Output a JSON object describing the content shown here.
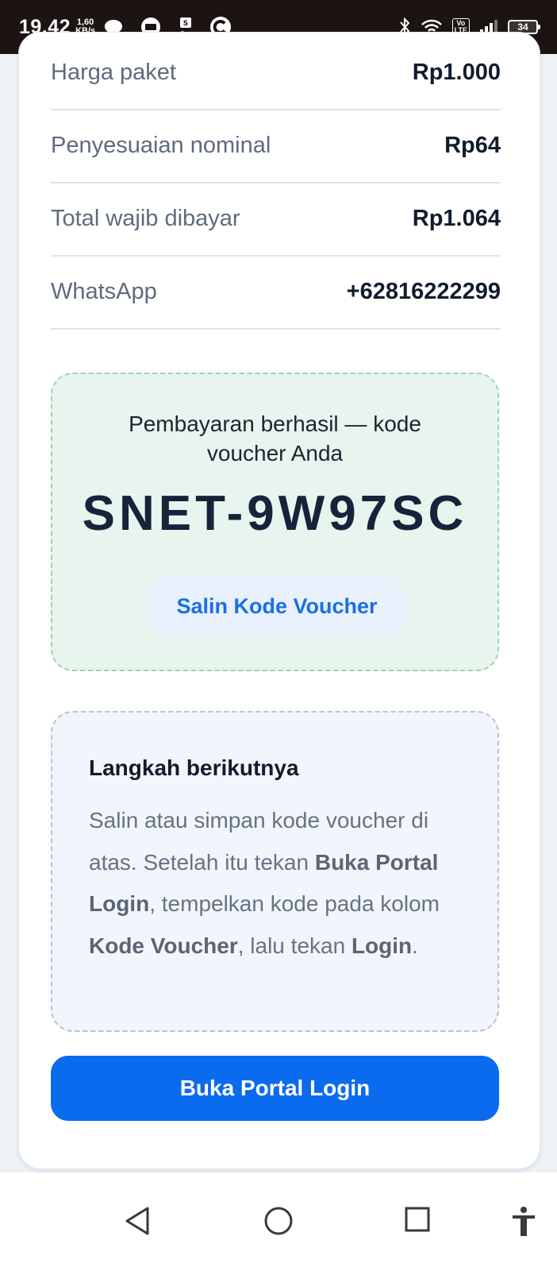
{
  "status_bar": {
    "time": "19.42",
    "speed_value": "1,60",
    "speed_unit": "KB/s",
    "battery": "34",
    "network_badge_top": "Vo",
    "network_badge_bottom": "LTE",
    "icons": [
      "chat-bubble-icon",
      "message-icon",
      "shopeepay-icon",
      "c-app-icon",
      "bluetooth-icon",
      "wifi-icon",
      "volte-icon",
      "signal-icon",
      "battery-icon"
    ]
  },
  "summary": {
    "rows": [
      {
        "label": "Harga paket",
        "value": "Rp1.000"
      },
      {
        "label": "Penyesuaian nominal",
        "value": "Rp64"
      },
      {
        "label": "Total wajib dibayar",
        "value": "Rp1.064"
      },
      {
        "label": "WhatsApp",
        "value": "+62816222299"
      }
    ]
  },
  "voucher": {
    "caption": "Pembayaran berhasil — kode voucher Anda",
    "code": "SNET-9W97SC",
    "copy_label": "Salin Kode Voucher"
  },
  "steps": {
    "title": "Langkah berikutnya",
    "text_1": "Salin atau simpan kode voucher di atas. Setelah itu tekan ",
    "bold_1": "Buka Portal Login",
    "text_2": ", tempelkan kode pada kolom ",
    "bold_2": "Kode Voucher",
    "text_3": ", lalu tekan ",
    "bold_3": "Login",
    "text_4": "."
  },
  "portal_button": {
    "label": "Buka Portal Login"
  },
  "nav": {
    "icons": [
      "back-icon",
      "home-icon",
      "recents-icon",
      "accessibility-icon"
    ]
  },
  "colors": {
    "accent": "#0b6bef",
    "success_bg": "#e8f5ee",
    "text_dark": "#111c2e",
    "text_muted": "#5f6b7c"
  }
}
